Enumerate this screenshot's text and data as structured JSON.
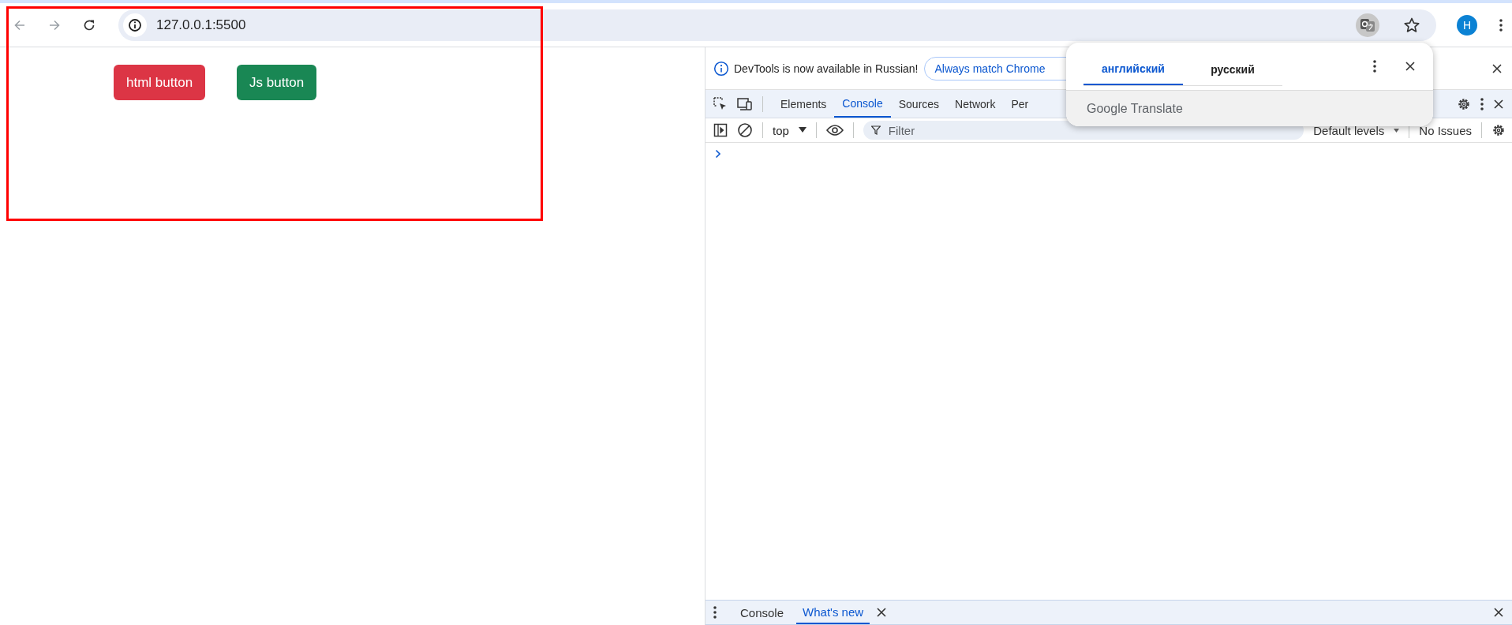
{
  "browser": {
    "address": "127.0.0.1:5500",
    "profile_initial": "H"
  },
  "page": {
    "buttons": [
      {
        "label": "html button",
        "color": "#dc3545"
      },
      {
        "label": "Js button",
        "color": "#198754"
      }
    ]
  },
  "devtools": {
    "infobar": {
      "message": "DevTools is now available in Russian!",
      "action": "Always match Chrome"
    },
    "tabs": [
      {
        "label": "Elements",
        "selected": false
      },
      {
        "label": "Console",
        "selected": true
      },
      {
        "label": "Sources",
        "selected": false
      },
      {
        "label": "Network",
        "selected": false
      },
      {
        "label": "Per",
        "selected": false
      }
    ],
    "context": "top",
    "filter_placeholder": "Filter",
    "levels": "Default levels",
    "issues": "No Issues",
    "drawer_tabs": [
      {
        "label": "Console",
        "selected": false,
        "closable": false
      },
      {
        "label": "What's new",
        "selected": true,
        "closable": true
      }
    ]
  },
  "translate_popup": {
    "languages": [
      {
        "label": "английский",
        "selected": true
      },
      {
        "label": "русский",
        "selected": false
      }
    ],
    "footer": "Google Translate"
  }
}
